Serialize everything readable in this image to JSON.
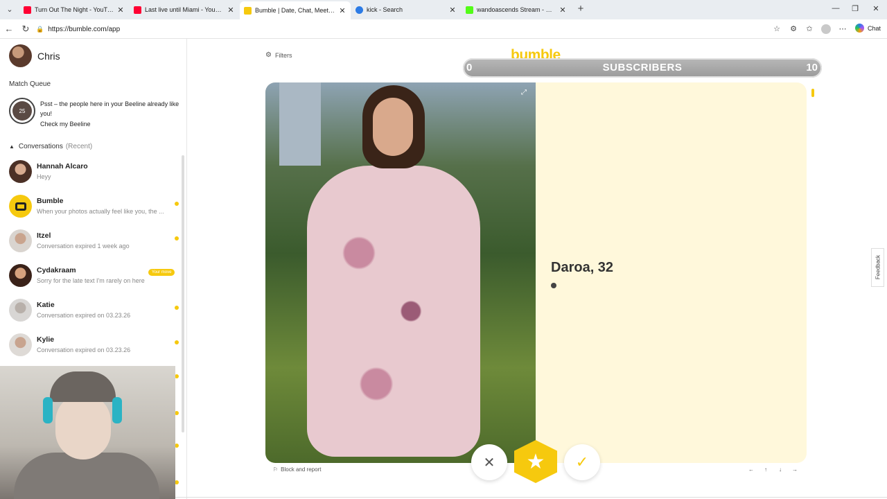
{
  "browser": {
    "tabs": [
      {
        "title": "Turn Out The Night - YouTube",
        "color": "#ff0033"
      },
      {
        "title": "Last live until Miami - YouTube",
        "color": "#ff0033"
      },
      {
        "title": "Bumble | Date, Chat, Meet New Pe",
        "color": "#f6c90e"
      },
      {
        "title": "kick - Search",
        "color": "#2c7be5"
      },
      {
        "title": "wandoascends Stream - Watch Liv",
        "color": "#53fc18"
      }
    ],
    "url": "https://bumble.com/app",
    "copilot_label": "Chat"
  },
  "sidebar": {
    "user_name": "Chris",
    "match_queue_label": "Match Queue",
    "beeline": {
      "count": "25",
      "text": "Psst – the people here in your Beeline already like you!",
      "link": "Check my Beeline"
    },
    "conversations_label": "Conversations",
    "conversations_sub": "(Recent)",
    "conversations": [
      {
        "name": "Hannah Alcaro",
        "preview": "Heyy"
      },
      {
        "name": "Bumble",
        "preview": "When your photos actually feel like you, the ..."
      },
      {
        "name": "Itzel",
        "preview": "Conversation expired 1 week ago"
      },
      {
        "name": "Cydakraam",
        "preview": "Sorry for the late text I'm rarely on here",
        "badge": "Your move"
      },
      {
        "name": "Katie",
        "preview": "Conversation expired on 03.23.26"
      },
      {
        "name": "Kylie",
        "preview": "Conversation expired on 03.23.26"
      }
    ]
  },
  "main": {
    "filters_label": "Filters",
    "brand": "bumble",
    "subscribers": {
      "label": "SUBSCRIBERS",
      "low": "0",
      "high": "10"
    },
    "profile": {
      "name_age": "Daroa, 32"
    },
    "report_label": "Block and report",
    "feedback_label": "Feedback"
  },
  "colors": {
    "accent": "#f6c90e"
  }
}
